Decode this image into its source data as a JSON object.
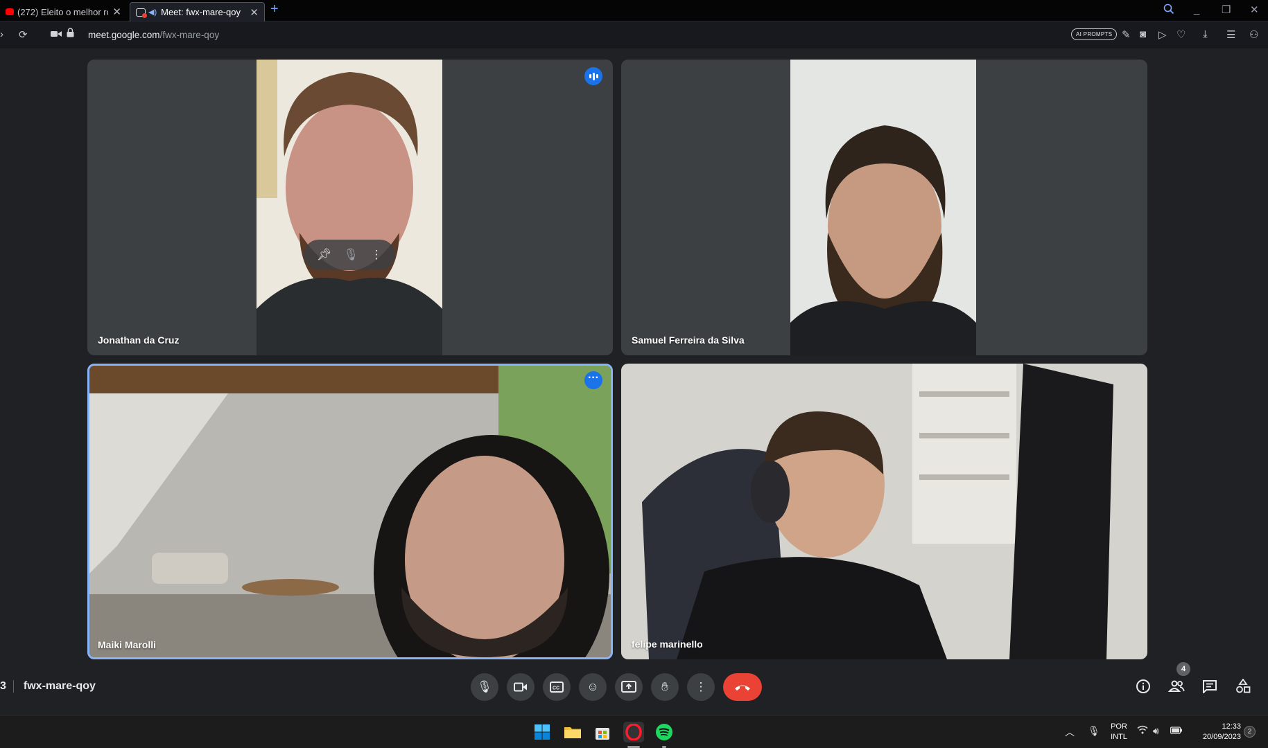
{
  "browser": {
    "tabs": [
      {
        "title": "(272) Eleito o melhor rodízi",
        "active": false
      },
      {
        "title": "Meet: fwx-mare-qoy",
        "active": true
      }
    ],
    "new_tab": "+",
    "url_domain": "meet.google.com",
    "url_path": "/fwx-mare-qoy",
    "ai_prompts": "AI PROMPTS"
  },
  "meeting": {
    "code_prefix": "3",
    "code": "fwx-mare-qoy",
    "participant_count": "4",
    "participants": [
      {
        "name": "Jonathan da Cruz",
        "speaking": true
      },
      {
        "name": "Samuel Ferreira da Silva",
        "speaking": false
      },
      {
        "name": "Maiki Marolli",
        "speaking": false,
        "highlighted": true
      },
      {
        "name": "felipe marinello",
        "speaking": false
      }
    ]
  },
  "colors": {
    "accent": "#1a73e8",
    "end_call": "#ea4335",
    "tile_bg": "#3c4043",
    "stage_bg": "#202124"
  },
  "taskbar": {
    "lang_top": "POR",
    "lang_bottom": "INTL",
    "time": "12:33",
    "date": "20/09/2023",
    "notifications": "2"
  }
}
